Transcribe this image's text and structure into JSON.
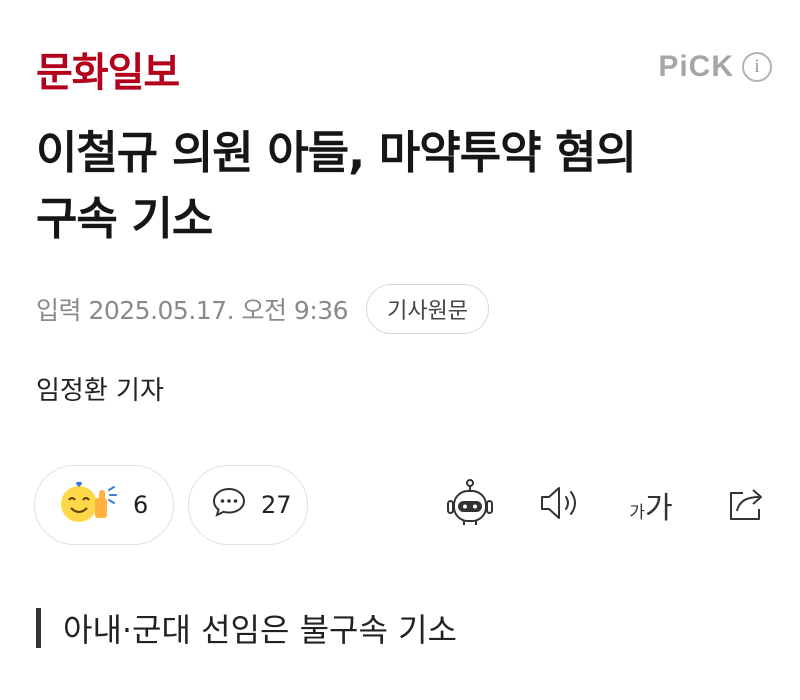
{
  "header": {
    "logo": "문화일보",
    "pick_label": "PiCK",
    "info_glyph": "i"
  },
  "article": {
    "title_line1": "이철규 의원 아들, 마약투약 혐의",
    "title_line2": "구속 기소",
    "date": "입력 2025.05.17. 오전 9:36",
    "original_button": "기사원문",
    "reporter": "임정환 기자",
    "subheading": "아내·군대 선임은 불구속 기소"
  },
  "actions": {
    "reaction_count": "6",
    "comment_count": "27",
    "font_small": "가",
    "font_big": "가",
    "icons": [
      "reaction-emoji-icon",
      "comment-icon",
      "robot-summary-icon",
      "speaker-icon",
      "font-size-icon",
      "share-icon"
    ]
  },
  "colors": {
    "brand": "#b3001b",
    "meta_gray": "#8a8a8a",
    "border": "#e0e0e0"
  }
}
